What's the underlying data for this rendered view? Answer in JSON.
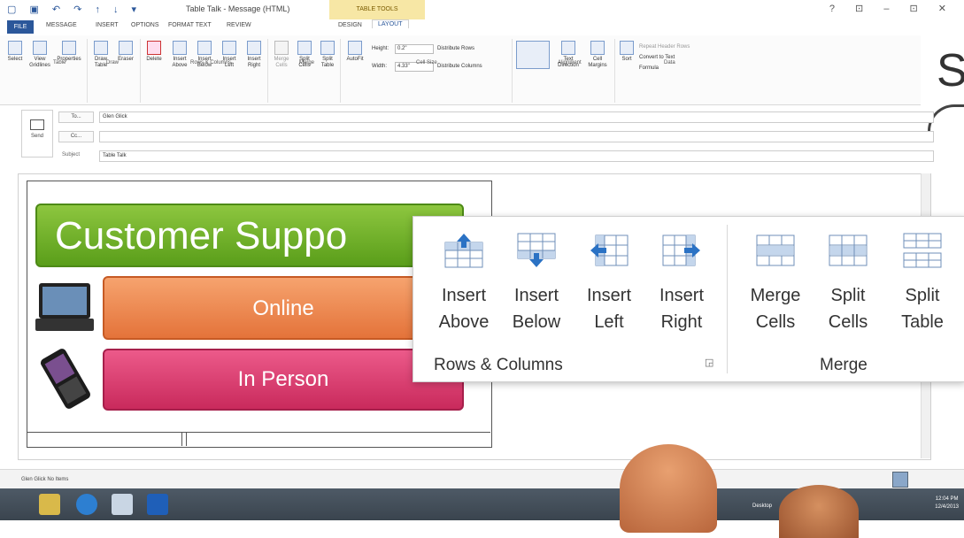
{
  "titlebar": {
    "title": "Table Talk - Message (HTML)",
    "context_label": "TABLE TOOLS",
    "window_controls": "?  ⊡  –  ⊡  ✕"
  },
  "tabs": [
    "FILE",
    "MESSAGE",
    "INSERT",
    "OPTIONS",
    "FORMAT TEXT",
    "REVIEW",
    "DESIGN",
    "LAYOUT"
  ],
  "ribbon": {
    "table": {
      "select": "Select",
      "view_gridlines": "View Gridlines",
      "properties": "Properties",
      "group": "Table"
    },
    "draw": {
      "draw_table": "Draw Table",
      "eraser": "Eraser",
      "group": "Draw"
    },
    "rows_cols": {
      "delete": "Delete",
      "insert_above": "Insert Above",
      "insert_below": "Insert Below",
      "insert_left": "Insert Left",
      "insert_right": "Insert Right",
      "group": "Rows & Columns"
    },
    "merge": {
      "merge_cells": "Merge Cells",
      "split_cells": "Split Cells",
      "split_table": "Split Table",
      "group": "Merge"
    },
    "cell_size": {
      "autofit": "AutoFit",
      "height_label": "Height:",
      "height_value": "0.2\"",
      "width_label": "Width:",
      "width_value": "4.33\"",
      "distribute_rows": "Distribute Rows",
      "distribute_columns": "Distribute Columns",
      "group": "Cell Size"
    },
    "alignment": {
      "text_direction": "Text Direction",
      "cell_margins": "Cell Margins",
      "group": "Alignment"
    },
    "data": {
      "sort": "Sort",
      "repeat_header": "Repeat Header Rows",
      "convert": "Convert to Text",
      "formula": "Formula",
      "group": "Data"
    }
  },
  "header": {
    "send": "Send",
    "to_button": "To...",
    "to_value": "Glen Glick",
    "cc_button": "Cc...",
    "cc_value": "",
    "subject_label": "Subject",
    "subject_value": "Table Talk"
  },
  "body": {
    "banner_title": "Customer Suppo",
    "online": "Online",
    "in_person": "In Person"
  },
  "popup": {
    "insert_above": [
      "Insert",
      "Above"
    ],
    "insert_below": [
      "Insert",
      "Below"
    ],
    "insert_left": [
      "Insert",
      "Left"
    ],
    "insert_right": [
      "Insert",
      "Right"
    ],
    "merge_cells": [
      "Merge",
      "Cells"
    ],
    "split_cells": [
      "Split",
      "Cells"
    ],
    "split_table": [
      "Split",
      "Table"
    ],
    "group_rows": "Rows & Columns",
    "group_merge": "Merge"
  },
  "status": {
    "text": "Glen Glick  No Items"
  },
  "taskbar": {
    "desktop": "Desktop",
    "time": "12:04 PM",
    "date": "12/4/2013"
  },
  "logo": {
    "letter": "S"
  },
  "colors": {
    "accent": "#2b579a",
    "green": "#8dc63f",
    "orange": "#f19a5e",
    "pink": "#e0457a"
  }
}
